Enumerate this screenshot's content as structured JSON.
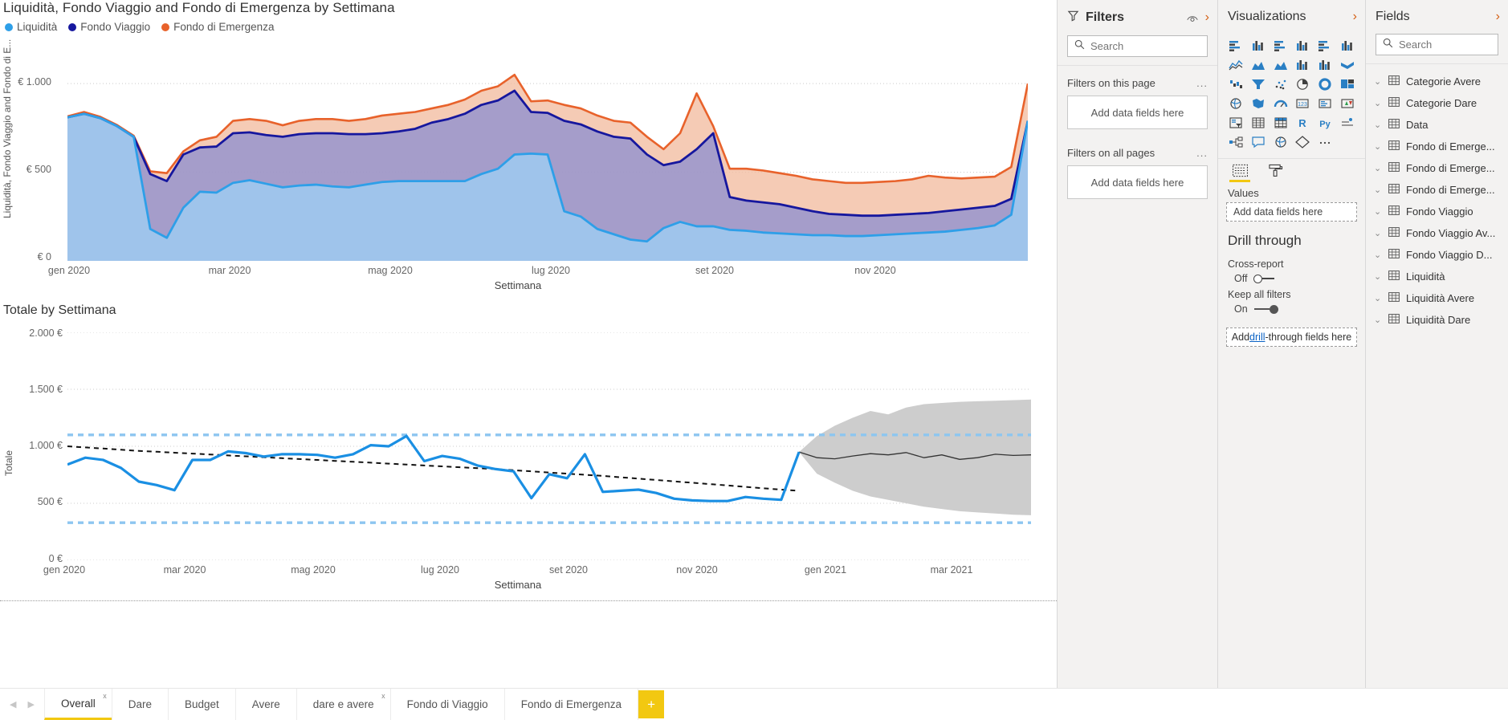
{
  "canvas": {
    "area_visual": {
      "title": "Liquidità, Fondo Viaggio and Fondo di Emergenza by Settimana",
      "y_axis_title": "Liquidità, Fondo Viaggio and Fondo di E...",
      "x_axis_title": "Settimana"
    },
    "line_visual": {
      "title": "Totale by Settimana",
      "y_axis_title": "Totale",
      "x_axis_title": "Settimana"
    }
  },
  "chart_data": [
    {
      "type": "area",
      "title": "Liquidità, Fondo Viaggio and Fondo di Emergenza by Settimana",
      "xlabel": "Settimana",
      "ylabel": "Liquidità, Fondo Viaggio and Fondo di E...",
      "ylim": [
        0,
        1200
      ],
      "yticks": [
        0,
        500,
        1000
      ],
      "ytick_labels": [
        "€ 0",
        "€ 500",
        "€ 1.000"
      ],
      "xtick_labels": [
        "gen 2020",
        "mar 2020",
        "mag 2020",
        "lug 2020",
        "set 2020",
        "nov 2020"
      ],
      "xtick_positions": [
        0,
        9,
        18,
        27,
        36,
        45
      ],
      "grid": true,
      "legend_position": "top-left",
      "legend": [
        {
          "name": "Liquidità",
          "color": "#2E9FE8"
        },
        {
          "name": "Fondo Viaggio",
          "color": "#16179E"
        },
        {
          "name": "Fondo di Emergenza",
          "color": "#E8622B"
        }
      ],
      "series": [
        {
          "name": "Liquidità",
          "color": "#2E9FE8",
          "fill": "#9ED0F5",
          "values": [
            810,
            830,
            805,
            760,
            700,
            180,
            130,
            300,
            390,
            385,
            440,
            455,
            435,
            415,
            425,
            430,
            420,
            415,
            430,
            445,
            450,
            450,
            450,
            450,
            450,
            490,
            520,
            600,
            605,
            600,
            280,
            250,
            180,
            150,
            120,
            110,
            185,
            220,
            195,
            195,
            175,
            170,
            160,
            155,
            150,
            145,
            145,
            140,
            140,
            145,
            150,
            155,
            160,
            165,
            175,
            185,
            200,
            260,
            790
          ]
        },
        {
          "name": "Fondo Viaggio",
          "color": "#16179E",
          "fill": "#8E8FD0",
          "values": [
            810,
            830,
            805,
            760,
            700,
            490,
            450,
            600,
            640,
            645,
            720,
            725,
            710,
            700,
            715,
            720,
            720,
            715,
            715,
            720,
            730,
            745,
            780,
            800,
            830,
            880,
            905,
            960,
            840,
            835,
            790,
            770,
            730,
            700,
            690,
            600,
            540,
            560,
            630,
            720,
            360,
            340,
            330,
            320,
            300,
            280,
            265,
            260,
            255,
            255,
            260,
            265,
            270,
            280,
            290,
            300,
            310,
            350,
            790
          ]
        },
        {
          "name": "Fondo di Emergenza",
          "color": "#E8622B",
          "fill": "#F2BCA0",
          "values": [
            815,
            840,
            812,
            766,
            706,
            505,
            495,
            618,
            680,
            700,
            790,
            800,
            790,
            765,
            790,
            800,
            800,
            790,
            800,
            820,
            830,
            840,
            860,
            880,
            910,
            960,
            985,
            1050,
            900,
            905,
            880,
            860,
            820,
            790,
            780,
            700,
            630,
            720,
            945,
            760,
            520,
            520,
            510,
            495,
            480,
            460,
            450,
            440,
            440,
            445,
            450,
            460,
            480,
            470,
            465,
            470,
            475,
            530,
            1000
          ]
        }
      ]
    },
    {
      "type": "line",
      "title": "Totale by Settimana",
      "xlabel": "Settimana",
      "ylabel": "Totale",
      "ylim": [
        0,
        2000
      ],
      "yticks": [
        0,
        500,
        1000,
        1500,
        2000
      ],
      "ytick_labels": [
        "0 €",
        "500 €",
        "1.000 €",
        "1.500 €",
        "2.000 €"
      ],
      "xtick_labels": [
        "gen 2020",
        "mar 2020",
        "mag 2020",
        "lug 2020",
        "set 2020",
        "nov 2020",
        "gen 2021",
        "mar 2021"
      ],
      "grid": true,
      "series": [
        {
          "name": "Totale",
          "color": "#1A8FE3",
          "values": [
            840,
            900,
            880,
            810,
            690,
            660,
            615,
            880,
            880,
            955,
            940,
            910,
            930,
            930,
            925,
            900,
            930,
            1010,
            1000,
            1090,
            870,
            915,
            890,
            830,
            800,
            780,
            545,
            755,
            720,
            930,
            600,
            610,
            620,
            590,
            540,
            525,
            520,
            520,
            555,
            540,
            530,
            950
          ]
        },
        {
          "name": "Trend line",
          "color": "#000000",
          "style": "dashed",
          "values": [
            1000,
            990,
            980,
            970,
            960,
            952,
            944,
            936,
            928,
            920,
            912,
            904,
            896,
            888,
            880,
            872,
            864,
            856,
            848,
            840,
            832,
            824,
            816,
            808,
            800,
            790,
            780,
            770,
            760,
            750,
            740,
            728,
            716,
            704,
            692,
            680,
            668,
            656,
            644,
            632,
            620,
            610
          ]
        },
        {
          "name": "Forecast",
          "color": "#333333",
          "style": "solid-thin",
          "values": [
            950,
            900,
            890,
            915,
            935,
            925,
            945,
            900,
            925,
            885,
            900,
            930,
            920,
            925
          ]
        },
        {
          "name": "Confidence band upper",
          "color": "#C8C8C8",
          "values": [
            950,
            1090,
            1180,
            1250,
            1310,
            1280,
            1340,
            1370,
            1380,
            1390,
            1395,
            1400,
            1405,
            1410
          ]
        },
        {
          "name": "Confidence band lower",
          "color": "#C8C8C8",
          "values": [
            950,
            760,
            680,
            610,
            560,
            530,
            500,
            470,
            450,
            430,
            420,
            410,
            400,
            395
          ]
        }
      ],
      "constant_lines": [
        {
          "value": 1100,
          "color": "#8DC6F0",
          "style": "dashed"
        },
        {
          "value": 330,
          "color": "#8DC6F0",
          "style": "dashed"
        }
      ]
    }
  ],
  "filters_pane": {
    "title": "Filters",
    "search_placeholder": "Search",
    "groups": [
      {
        "label": "Filters on this page",
        "dropzone": "Add data fields here",
        "menu": "..."
      },
      {
        "label": "Filters on all pages",
        "dropzone": "Add data fields here",
        "menu": "..."
      }
    ]
  },
  "visualizations_pane": {
    "title": "Visualizations",
    "icons": [
      "stacked-bar-chart-icon",
      "stacked-column-chart-icon",
      "clustered-bar-chart-icon",
      "clustered-column-chart-icon",
      "hundred-stacked-bar-chart-icon",
      "hundred-stacked-column-chart-icon",
      "line-chart-icon",
      "area-chart-icon",
      "stacked-area-chart-icon",
      "line-stacked-column-chart-icon",
      "line-clustered-column-chart-icon",
      "ribbon-chart-icon",
      "waterfall-chart-icon",
      "funnel-chart-icon",
      "scatter-chart-icon",
      "pie-chart-icon",
      "donut-chart-icon",
      "treemap-icon",
      "map-icon",
      "filled-map-icon",
      "gauge-icon",
      "card-icon",
      "multi-row-card-icon",
      "kpi-icon",
      "slicer-icon",
      "table-icon",
      "matrix-icon",
      "r-script-visual-icon",
      "python-visual-icon",
      "key-influencers-icon",
      "decomposition-tree-icon",
      "q-and-a-icon",
      "arcgis-maps-icon",
      "paginated-report-icon",
      "more-options-icon"
    ],
    "format_tabs": [
      {
        "name": "fields-tab-icon",
        "active": true
      },
      {
        "name": "format-paint-roller-icon",
        "active": false
      }
    ],
    "values_label": "Values",
    "values_dropzone": "Add data fields here",
    "drill_through": {
      "title": "Drill through",
      "cross_report_label": "Cross-report",
      "cross_report_state": "Off",
      "keep_all_filters_label": "Keep all filters",
      "keep_all_filters_state": "On",
      "dropzone_prefix": "Add ",
      "dropzone_link": "drill",
      "dropzone_suffix": "-through fields here"
    }
  },
  "fields_pane": {
    "title": "Fields",
    "search_placeholder": "Search",
    "tables": [
      "Categorie Avere",
      "Categorie Dare",
      "Data",
      "Fondo di Emerge...",
      "Fondo di Emerge...",
      "Fondo di Emerge...",
      "Fondo Viaggio",
      "Fondo Viaggio Av...",
      "Fondo Viaggio D...",
      "Liquidità",
      "Liquidità Avere",
      "Liquidità Dare"
    ]
  },
  "tabbar": {
    "prev_arrow": "◀",
    "next_arrow": "▶",
    "add_label": "+",
    "tabs": [
      {
        "label": "Overall",
        "active": true,
        "closable": true
      },
      {
        "label": "Dare",
        "active": false,
        "closable": false
      },
      {
        "label": "Budget",
        "active": false,
        "closable": false
      },
      {
        "label": "Avere",
        "active": false,
        "closable": false
      },
      {
        "label": "dare e avere",
        "active": false,
        "closable": true
      },
      {
        "label": "Fondo di Viaggio",
        "active": false,
        "closable": false
      },
      {
        "label": "Fondo di Emergenza",
        "active": false,
        "closable": false
      }
    ]
  }
}
